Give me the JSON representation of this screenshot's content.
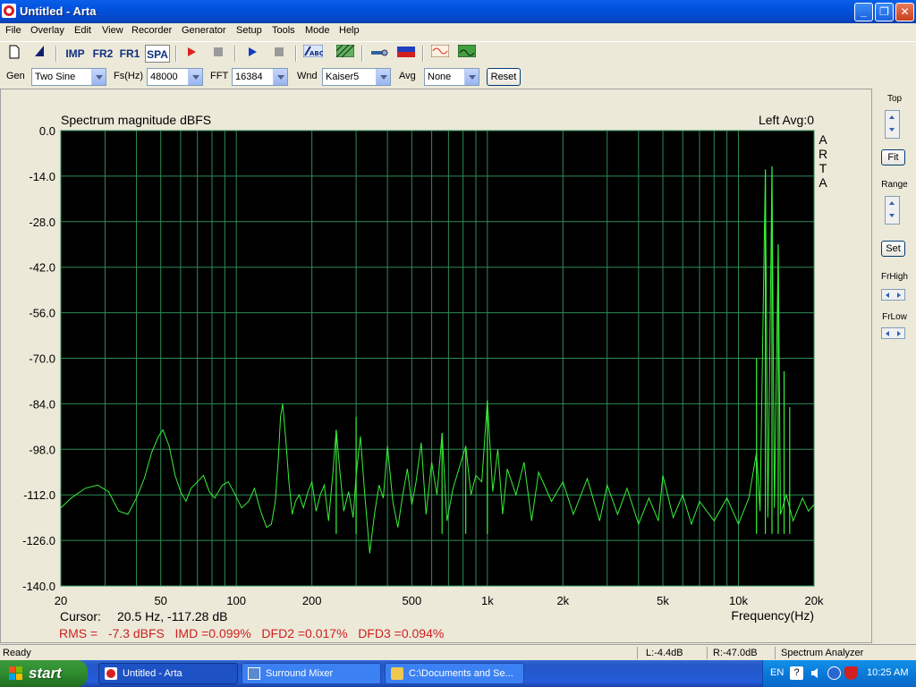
{
  "window": {
    "title": "Untitled - Arta"
  },
  "menu": [
    "File",
    "Overlay",
    "Edit",
    "View",
    "Recorder",
    "Generator",
    "Setup",
    "Tools",
    "Mode",
    "Help"
  ],
  "toolbar": {
    "imp": "IMP",
    "fr2": "FR2",
    "fr1": "FR1",
    "spa": "SPA"
  },
  "settings": {
    "gen_label": "Gen",
    "gen_value": "Two Sine",
    "fs_label": "Fs(Hz)",
    "fs_value": "48000",
    "fft_label": "FFT",
    "fft_value": "16384",
    "wnd_label": "Wnd",
    "wnd_value": "Kaiser5",
    "avg_label": "Avg",
    "avg_value": "None",
    "reset_label": "Reset"
  },
  "chart_data": {
    "type": "line",
    "title": "Spectrum magnitude dBFS",
    "right_title": "Left  Avg:0",
    "watermark": "ARTA",
    "xlabel": "Frequency(Hz)",
    "x_scale": "log",
    "xlim": [
      20,
      20000
    ],
    "ylim": [
      -140,
      0
    ],
    "x_tick_labels": [
      "20",
      "50",
      "100",
      "200",
      "500",
      "1k",
      "2k",
      "5k",
      "10k",
      "20k"
    ],
    "x_tick_values": [
      20,
      50,
      100,
      200,
      500,
      1000,
      2000,
      5000,
      10000,
      20000
    ],
    "y_tick_labels": [
      "0.0",
      "-14.0",
      "-28.0",
      "-42.0",
      "-56.0",
      "-70.0",
      "-84.0",
      "-98.0",
      "-112.0",
      "-126.0",
      "-140.0"
    ],
    "y_tick_values": [
      0,
      -14,
      -28,
      -42,
      -56,
      -70,
      -84,
      -98,
      -112,
      -126,
      -140
    ],
    "grid": true,
    "colors": {
      "plot_bg": "#000000",
      "grid": "#2E8B57",
      "trace": "#38F038"
    },
    "series": [
      {
        "points": [
          [
            20,
            -116
          ],
          [
            22,
            -113
          ],
          [
            25,
            -110
          ],
          [
            28,
            -109
          ],
          [
            31,
            -111
          ],
          [
            34,
            -117
          ],
          [
            37,
            -118
          ],
          [
            40,
            -113
          ],
          [
            43,
            -107
          ],
          [
            46,
            -99
          ],
          [
            49,
            -94
          ],
          [
            51,
            -92
          ],
          [
            54,
            -97
          ],
          [
            57,
            -106
          ],
          [
            60,
            -111
          ],
          [
            63,
            -114
          ],
          [
            66,
            -110
          ],
          [
            70,
            -108
          ],
          [
            74,
            -106
          ],
          [
            78,
            -111
          ],
          [
            82,
            -113
          ],
          [
            88,
            -109
          ],
          [
            93,
            -108
          ],
          [
            99,
            -112
          ],
          [
            105,
            -116
          ],
          [
            112,
            -114
          ],
          [
            118,
            -110
          ],
          [
            125,
            -117
          ],
          [
            132,
            -122
          ],
          [
            138,
            -121
          ],
          [
            143,
            -114
          ],
          [
            147,
            -101
          ],
          [
            150,
            -88
          ],
          [
            153,
            -84
          ],
          [
            157,
            -94
          ],
          [
            162,
            -108
          ],
          [
            167,
            -118
          ],
          [
            172,
            -114
          ],
          [
            178,
            -112
          ],
          [
            185,
            -116
          ],
          [
            193,
            -111
          ],
          [
            200,
            -108
          ],
          [
            208,
            -117
          ],
          [
            216,
            -112
          ],
          [
            224,
            -109
          ],
          [
            233,
            -120
          ],
          [
            242,
            -106
          ],
          [
            250,
            -92
          ],
          [
            258,
            -104
          ],
          [
            268,
            -117
          ],
          [
            280,
            -111
          ],
          [
            292,
            -119
          ],
          [
            300,
            -106
          ],
          [
            312,
            -94
          ],
          [
            325,
            -112
          ],
          [
            340,
            -130
          ],
          [
            355,
            -118
          ],
          [
            370,
            -109
          ],
          [
            385,
            -113
          ],
          [
            400,
            -97
          ],
          [
            420,
            -114
          ],
          [
            440,
            -122
          ],
          [
            460,
            -112
          ],
          [
            480,
            -104
          ],
          [
            500,
            -115
          ],
          [
            520,
            -108
          ],
          [
            545,
            -96
          ],
          [
            570,
            -118
          ],
          [
            600,
            -102
          ],
          [
            630,
            -112
          ],
          [
            660,
            -93
          ],
          [
            690,
            -120
          ],
          [
            730,
            -110
          ],
          [
            770,
            -104
          ],
          [
            820,
            -97
          ],
          [
            860,
            -112
          ],
          [
            900,
            -106
          ],
          [
            950,
            -108
          ],
          [
            1000,
            -83
          ],
          [
            1050,
            -111
          ],
          [
            1100,
            -98
          ],
          [
            1150,
            -118
          ],
          [
            1200,
            -104
          ],
          [
            1300,
            -112
          ],
          [
            1400,
            -102
          ],
          [
            1500,
            -120
          ],
          [
            1600,
            -105
          ],
          [
            1800,
            -114
          ],
          [
            2000,
            -108
          ],
          [
            2200,
            -118
          ],
          [
            2500,
            -107
          ],
          [
            2800,
            -120
          ],
          [
            3000,
            -109
          ],
          [
            3300,
            -118
          ],
          [
            3600,
            -110
          ],
          [
            4000,
            -121
          ],
          [
            4400,
            -113
          ],
          [
            4800,
            -120
          ],
          [
            5000,
            -106
          ],
          [
            5500,
            -119
          ],
          [
            6000,
            -112
          ],
          [
            6500,
            -121
          ],
          [
            7000,
            -114
          ],
          [
            8000,
            -120
          ],
          [
            9000,
            -113
          ],
          [
            10000,
            -121
          ],
          [
            11000,
            -113
          ],
          [
            11800,
            -99
          ],
          [
            12200,
            -117
          ],
          [
            12800,
            -12
          ],
          [
            13100,
            -119
          ],
          [
            13600,
            -11
          ],
          [
            13900,
            -116
          ],
          [
            14400,
            -35
          ],
          [
            14700,
            -118
          ],
          [
            15500,
            -112
          ],
          [
            16500,
            -120
          ],
          [
            18000,
            -113
          ],
          [
            19000,
            -117
          ],
          [
            20000,
            -115
          ]
        ]
      }
    ],
    "spurs": [
      [
        1000,
        -83
      ],
      [
        300,
        -88
      ],
      [
        250,
        -92
      ],
      [
        660,
        -93
      ],
      [
        820,
        -97
      ],
      [
        11800,
        -70
      ],
      [
        12800,
        -12
      ],
      [
        13600,
        -11
      ],
      [
        14400,
        -35
      ],
      [
        15200,
        -74
      ],
      [
        16000,
        -85
      ]
    ],
    "cursor_label": "Cursor:",
    "cursor_value": "20.5 Hz, -117.28 dB",
    "measurements": "RMS =   -7.3 dBFS   IMD =0.099%   DFD2 =0.017%   DFD3 =0.094%"
  },
  "rightpanel": {
    "top": "Top",
    "fit": "Fit",
    "range": "Range",
    "set": "Set",
    "frhigh": "FrHigh",
    "frlow": "FrLow"
  },
  "statusbar": {
    "ready": "Ready",
    "left": "L:-4.4dB",
    "right": "R:-47.0dB",
    "mode": "Spectrum Analyzer"
  },
  "taskbar": {
    "start": "start",
    "tasks": [
      "Untitled - Arta",
      "Surround Mixer",
      "C:\\Documents and Se..."
    ],
    "lang": "EN",
    "clock": "10:25 AM"
  }
}
